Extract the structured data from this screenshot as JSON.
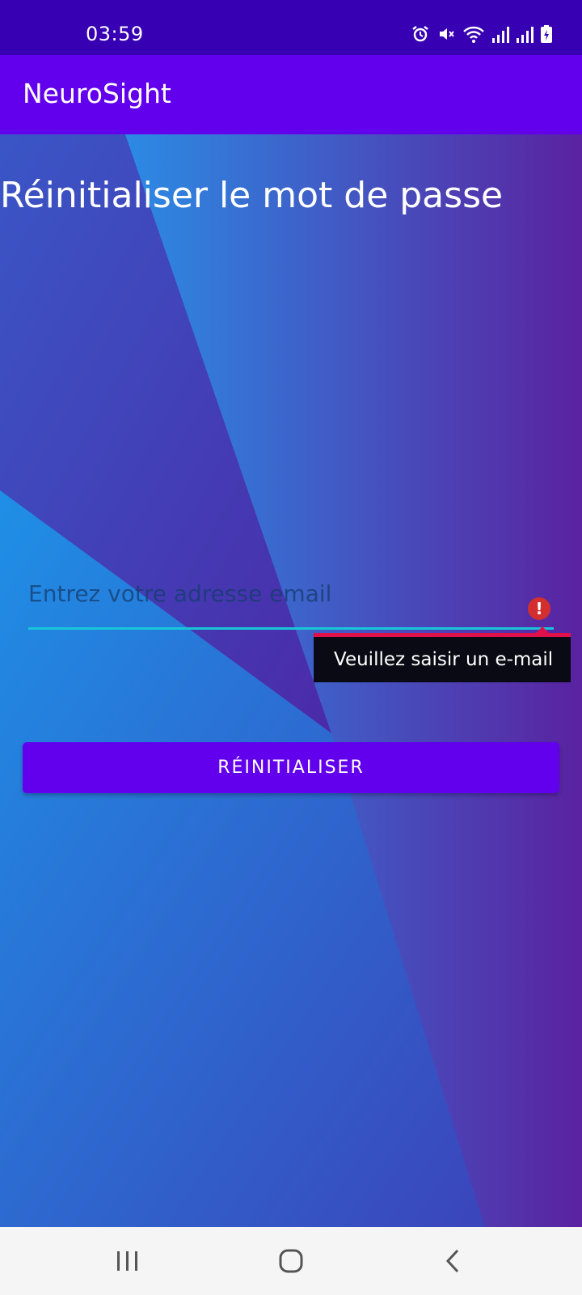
{
  "status_bar": {
    "time": "03:59",
    "icons": [
      "alarm-icon",
      "mute-icon",
      "wifi-icon",
      "signal-icon",
      "signal-icon",
      "battery-icon"
    ]
  },
  "app_bar": {
    "title": "NeuroSight"
  },
  "page": {
    "title": "Réinitialiser le mot de passe",
    "email_placeholder": "Entrez votre adresse email",
    "email_value": "",
    "error_message": "Veuillez saisir un e-mail",
    "reset_button_label": "RÉINITIALISER"
  },
  "nav_bar": {
    "buttons": [
      "recent-apps-icon",
      "home-icon",
      "back-icon"
    ]
  },
  "colors": {
    "status_bar": "#3700b3",
    "app_bar": "#6200ee",
    "button": "#6200ee",
    "field_underline": "#18c6d8",
    "error": "#e0114a",
    "error_icon": "#d32f2f"
  }
}
